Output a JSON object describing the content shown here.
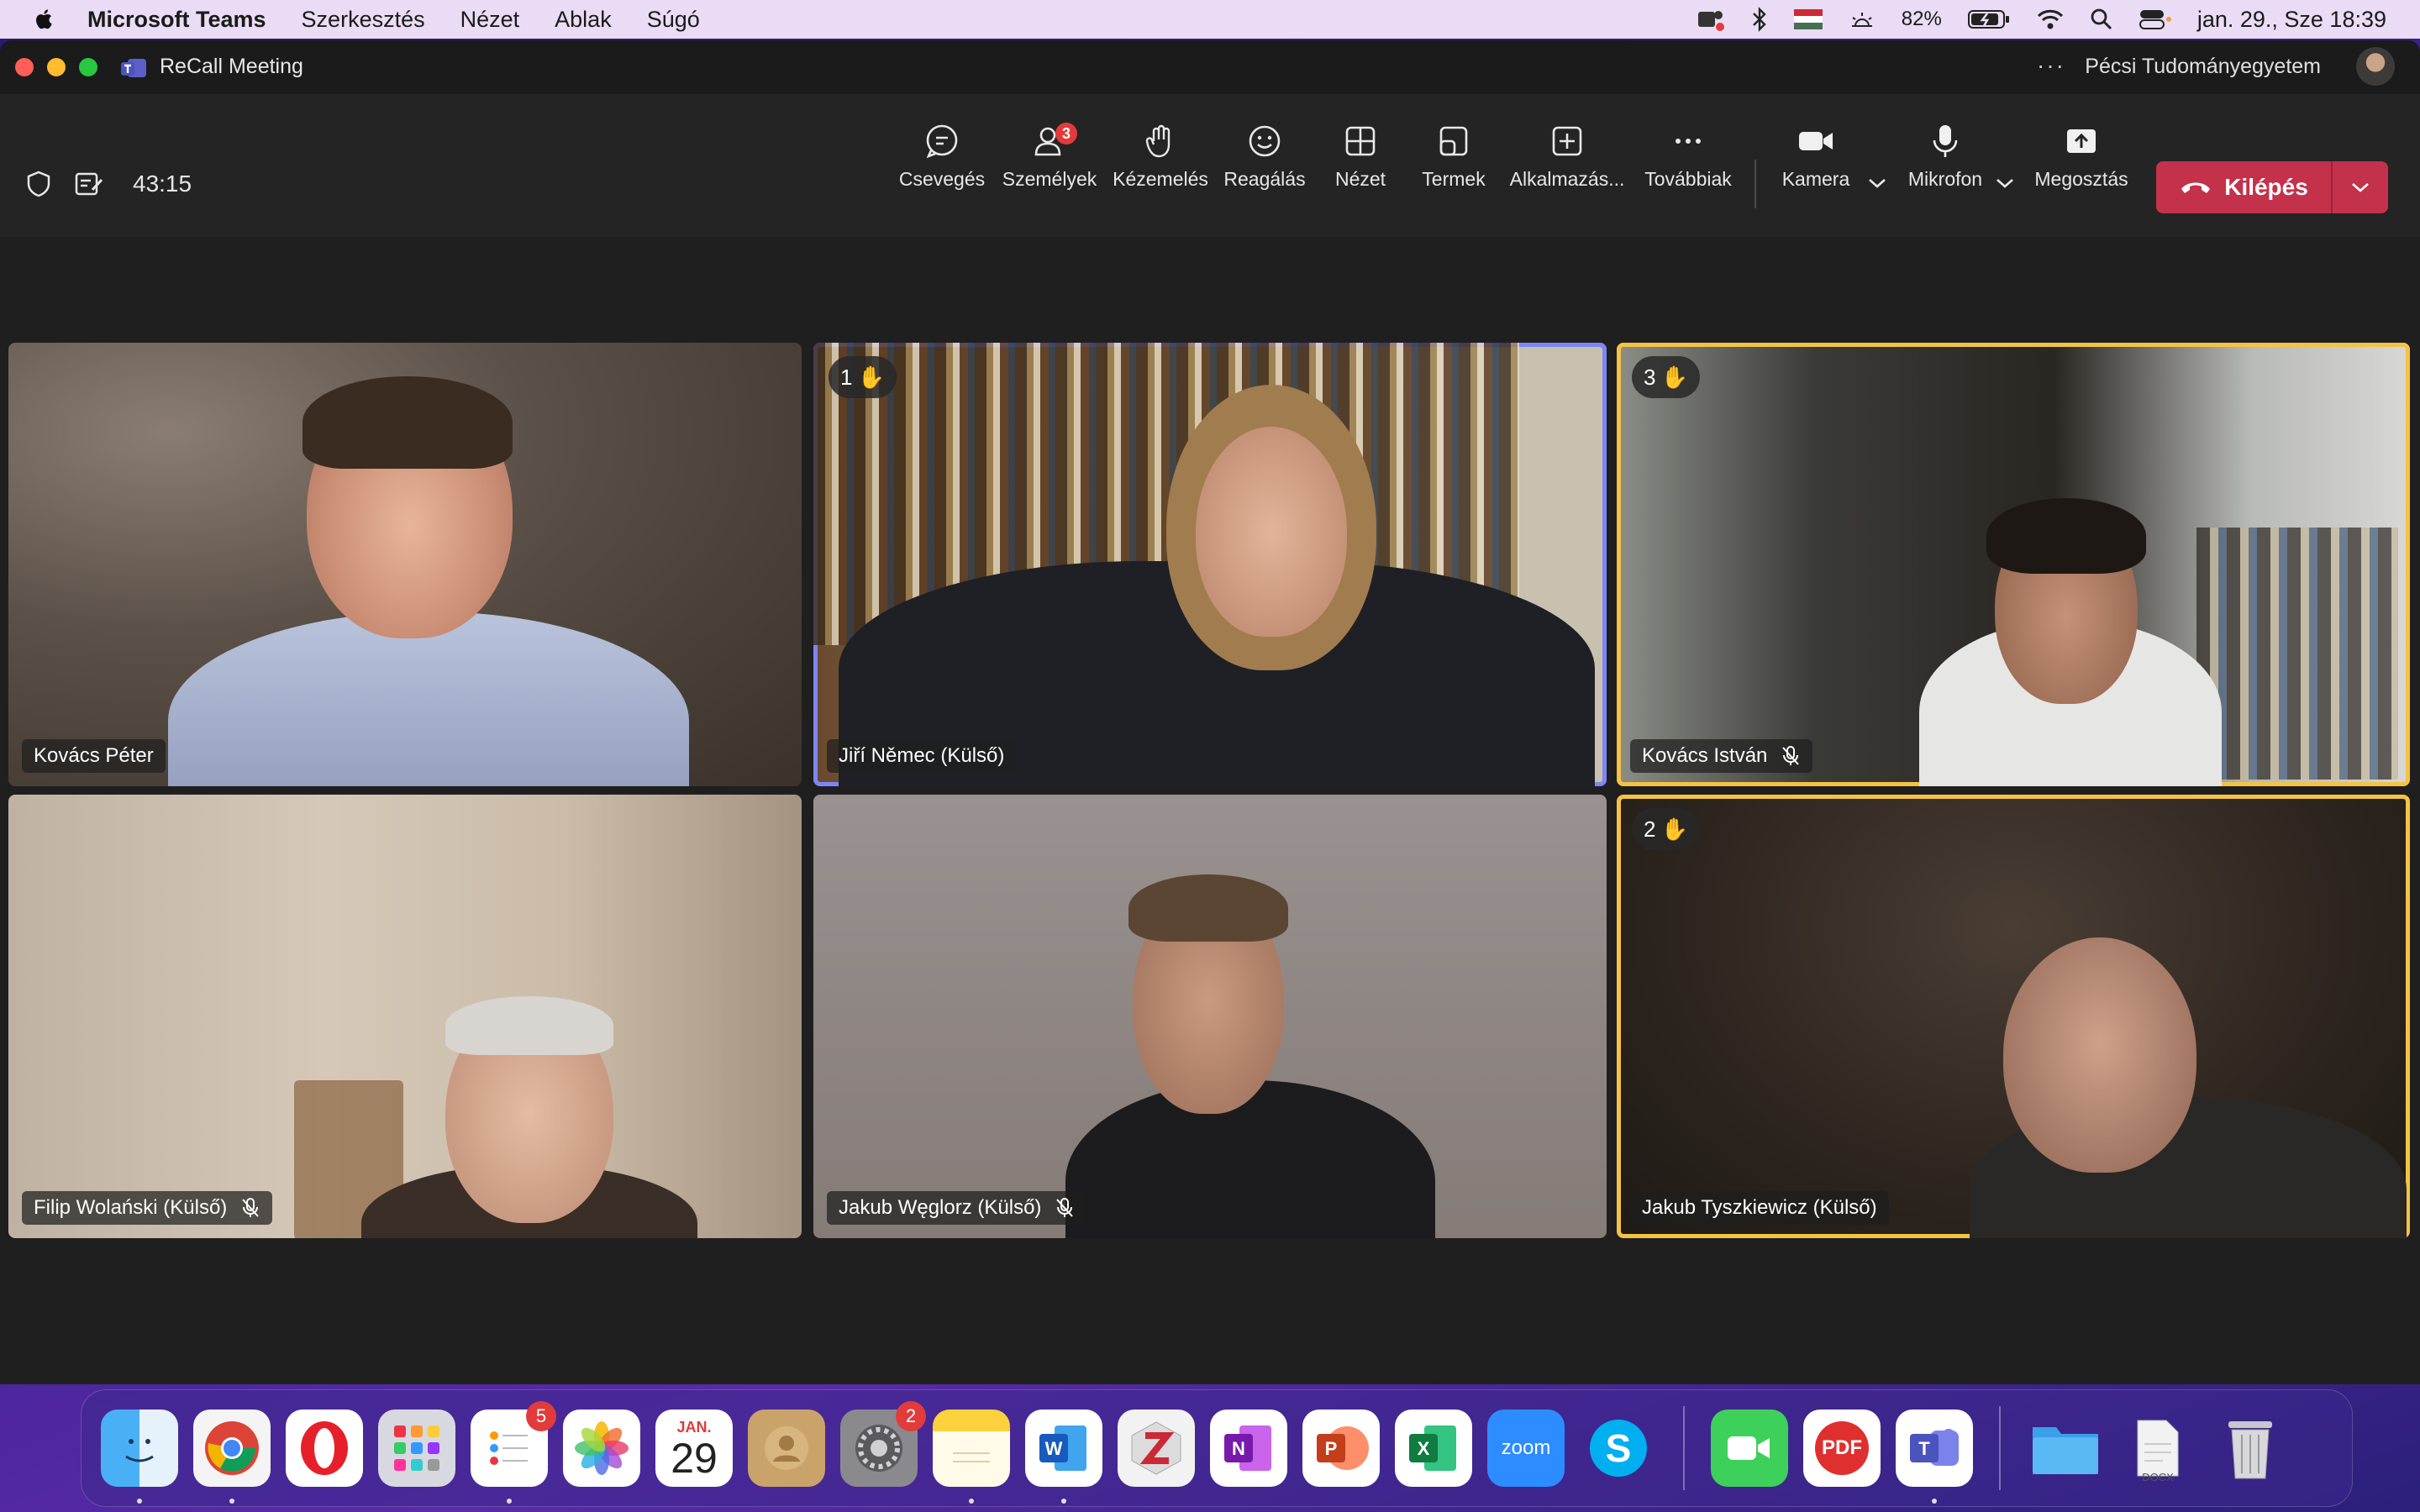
{
  "menubar": {
    "items": [
      "Microsoft Teams",
      "Szerkesztés",
      "Nézet",
      "Ablak",
      "Súgó"
    ],
    "battery": "82%",
    "datetime": "jan. 29., Sze  18:39"
  },
  "window": {
    "title": "ReCall Meeting",
    "more": "···",
    "org": "Pécsi Tudományegyetem"
  },
  "toolbar": {
    "timer": "43:15",
    "buttons": [
      {
        "label": "Csevegés",
        "icon": "chat-icon"
      },
      {
        "label": "Személyek",
        "icon": "people-icon",
        "badge": "3"
      },
      {
        "label": "Kézemelés",
        "icon": "raise-hand-icon"
      },
      {
        "label": "Reagálás",
        "icon": "smiley-icon"
      },
      {
        "label": "Nézet",
        "icon": "grid-view-icon"
      },
      {
        "label": "Termek",
        "icon": "rooms-icon"
      },
      {
        "label": "Alkalmazás...",
        "icon": "add-app-icon"
      },
      {
        "label": "Továbbiak",
        "icon": "more-icon"
      },
      {
        "label": "Kamera",
        "icon": "camera-icon"
      },
      {
        "label": "Mikrofon",
        "icon": "microphone-icon"
      },
      {
        "label": "Megosztás",
        "icon": "share-icon"
      }
    ],
    "leave_label": "Kilépés"
  },
  "participants": [
    {
      "name": "Kovács Péter",
      "muted": false,
      "hand": null
    },
    {
      "name": "Jiří Němec (Külső)",
      "muted": false,
      "hand": "1"
    },
    {
      "name": "Kovács István",
      "muted": true,
      "hand": "3"
    },
    {
      "name": "Filip Wolański (Külső)",
      "muted": true,
      "hand": null
    },
    {
      "name": "Jakub Węglorz (Külső)",
      "muted": true,
      "hand": null
    },
    {
      "name": "Jakub Tyszkiewicz (Külső)",
      "muted": false,
      "hand": "2"
    }
  ],
  "dock": {
    "reminders_badge": "5",
    "calendar_month": "JAN.",
    "calendar_day": "29",
    "settings_badge": "2",
    "zoom_label": "zoom",
    "pdf_label": "PDF",
    "docx_label": "DOCX"
  },
  "colors": {
    "leave": "#c4314b",
    "active_speaker": "#7f85f5",
    "raised_hand": "#f5c344"
  }
}
